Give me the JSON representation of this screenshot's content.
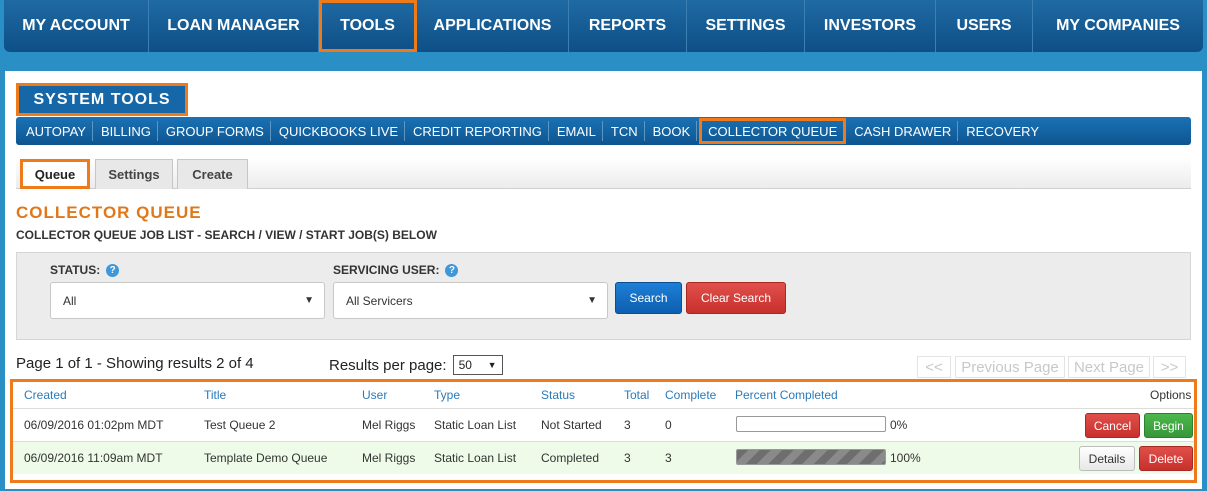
{
  "topnav": [
    {
      "label": "MY ACCOUNT",
      "width": 145
    },
    {
      "label": "LOAN MANAGER",
      "width": 170
    },
    {
      "label": "TOOLS",
      "width": 98,
      "active": true
    },
    {
      "label": "APPLICATIONS",
      "width": 152
    },
    {
      "label": "REPORTS",
      "width": 118
    },
    {
      "label": "SETTINGS",
      "width": 118
    },
    {
      "label": "INVESTORS",
      "width": 131
    },
    {
      "label": "USERS",
      "width": 97
    },
    {
      "label": "MY COMPANIES",
      "width": 170
    }
  ],
  "page_header": "SYSTEM TOOLS",
  "subnav": [
    "AUTOPAY",
    "BILLING",
    "GROUP FORMS",
    "QUICKBOOKS LIVE",
    "CREDIT REPORTING",
    "EMAIL",
    "TCN",
    "BOOK",
    "COLLECTOR QUEUE",
    "CASH DRAWER",
    "RECOVERY"
  ],
  "subnav_active": "COLLECTOR QUEUE",
  "tabs": [
    "Queue",
    "Settings",
    "Create"
  ],
  "section": {
    "title": "COLLECTOR QUEUE",
    "subtitle": "COLLECTOR QUEUE JOB LIST - SEARCH / VIEW / START JOB(S) BELOW"
  },
  "search": {
    "status_label": "STATUS:",
    "status_value": "All",
    "servicer_label": "SERVICING USER:",
    "servicer_value": "All Servicers",
    "search_button": "Search",
    "clear_button": "Clear Search",
    "help_glyph": "?"
  },
  "paging": {
    "summary": "Page 1 of 1 - Showing results 2 of 4",
    "rpp_label": "Results per page:",
    "rpp_value": "50",
    "first": "<<",
    "prev": "Previous Page",
    "next": "Next Page",
    "last": ">>"
  },
  "table": {
    "headers": [
      "Created",
      "Title",
      "User",
      "Type",
      "Status",
      "Total",
      "Complete",
      "Percent Completed",
      "Options"
    ],
    "rows": [
      {
        "created": "06/09/2016 01:02pm MDT",
        "title": "Test Queue 2",
        "user": "Mel Riggs",
        "type": "Static Loan List",
        "status": "Not Started",
        "total": "3",
        "complete": "0",
        "percent": 0,
        "percent_label": "0%",
        "actions": [
          "Cancel",
          "Begin"
        ]
      },
      {
        "created": "06/09/2016 11:09am MDT",
        "title": "Template Demo Queue",
        "user": "Mel Riggs",
        "type": "Static Loan List",
        "status": "Completed",
        "total": "3",
        "complete": "3",
        "percent": 100,
        "percent_label": "100%",
        "actions": [
          "Details",
          "Delete"
        ]
      }
    ]
  },
  "colors": {
    "accent_orange": "#ef7a1a",
    "nav_blue": "#0e4f86",
    "title_orange": "#e0781a"
  }
}
